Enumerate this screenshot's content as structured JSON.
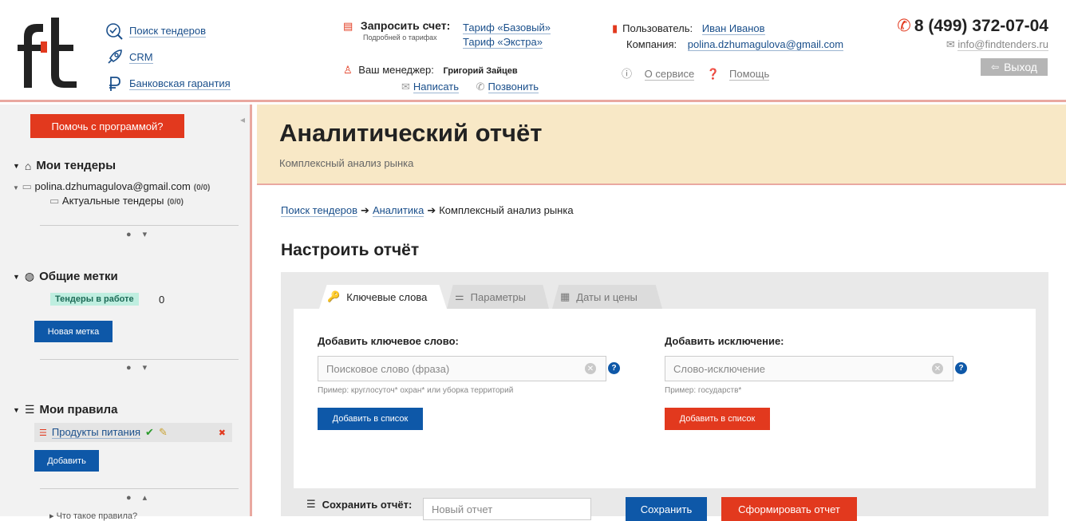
{
  "header": {
    "nav": [
      {
        "label": "Поиск тендеров",
        "icon": "search-check-icon"
      },
      {
        "label": "CRM",
        "icon": "rocket-icon"
      },
      {
        "label": "Банковская гарантия",
        "icon": "ruble-icon"
      }
    ],
    "invoice_label": "Запросить счет:",
    "invoice_sub": "Подробней о тарифах",
    "tariffs": [
      "Тариф «Базовый»",
      "Тариф «Экстра»"
    ],
    "manager_label": "Ваш менеджер:",
    "manager_name": "Григорий Зайцев",
    "write_label": "Написать",
    "call_label": "Позвонить",
    "user_label": "Пользователь:",
    "user_name": "Иван Иванов",
    "company_label": "Компания:",
    "company_value": "polina.dzhumagulova@gmail.com",
    "about_label": "О сервисе",
    "help_label": "Помощь",
    "phone": "8 (499) 372-07-04",
    "email": "info@findtenders.ru",
    "logout_label": "Выход"
  },
  "sidebar": {
    "help_button": "Помочь с программой?",
    "my_tenders_title": "Мои тендеры",
    "tree_root": "polina.dzhumagulova@gmail.com",
    "tree_root_count": "(0/0)",
    "tree_child": "Актуальные тендеры",
    "tree_child_count": "(0/0)",
    "common_tags_title": "Общие метки",
    "tag_label": "Тендеры в работе",
    "tag_count": "0",
    "new_tag_button": "Новая метка",
    "my_rules_title": "Мои правила",
    "rule_name": "Продукты питания",
    "add_button": "Добавить",
    "rules_help": "Что такое правила?"
  },
  "main": {
    "title": "Аналитический отчёт",
    "subtitle": "Комплексный анализ рынка",
    "breadcrumbs": [
      "Поиск тендеров",
      "Аналитика",
      "Комплексный анализ рынка"
    ],
    "section_title": "Настроить отчёт",
    "tabs": [
      "Ключевые слова",
      "Параметры",
      "Даты и цены"
    ],
    "keyword_label": "Добавить ключевое слово:",
    "keyword_placeholder": "Поисковое слово (фраза)",
    "keyword_hint": "Пример: круглосуточ* охран* или уборка территорий",
    "keyword_add": "Добавить в список",
    "exclusion_label": "Добавить исключение:",
    "exclusion_placeholder": "Слово-исключение",
    "exclusion_hint": "Пример: государств*",
    "exclusion_add": "Добавить в список",
    "save_label": "Сохранить отчёт:",
    "save_placeholder": "Новый отчет",
    "save_button": "Сохранить",
    "generate_button": "Сформировать отчет"
  },
  "colors": {
    "accent_red": "#e2391e",
    "accent_blue": "#0e58a8",
    "banner": "#f8e8c6"
  }
}
